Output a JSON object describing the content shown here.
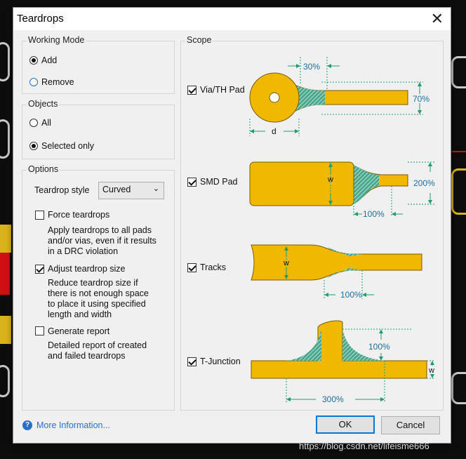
{
  "window": {
    "title": "Teardrops",
    "close_glyph": "✕"
  },
  "working_mode": {
    "label": "Working Mode",
    "options": [
      {
        "label": "Add",
        "selected": true
      },
      {
        "label": "Remove",
        "selected": false
      }
    ]
  },
  "objects": {
    "label": "Objects",
    "options": [
      {
        "label": "All",
        "selected": false
      },
      {
        "label": "Selected only",
        "selected": true
      }
    ]
  },
  "options": {
    "label": "Options",
    "teardrop_style_label": "Teardrop style",
    "teardrop_style_value": "Curved",
    "force": {
      "label": "Force teardrops",
      "checked": false,
      "desc": [
        "Apply teardrops to all pads",
        "and/or vias, even if it results",
        "in a DRC violation"
      ]
    },
    "adjust": {
      "label": "Adjust teardrop size",
      "checked": true,
      "desc": [
        "Reduce teardrop size if",
        "there is not enough space",
        "to place it using specified",
        "length and width"
      ]
    },
    "report": {
      "label": "Generate report",
      "checked": false,
      "desc": [
        "Detailed report of created",
        "and failed teardrops"
      ]
    }
  },
  "scope": {
    "label": "Scope",
    "items": [
      {
        "label": "Via/TH Pad",
        "checked": true
      },
      {
        "label": "SMD Pad",
        "checked": true
      },
      {
        "label": "Tracks",
        "checked": true
      },
      {
        "label": "T-Junction",
        "checked": true
      }
    ],
    "annotations": {
      "via_length": "30%",
      "via_width": "70%",
      "via_d": "d",
      "smd_w": "w",
      "smd_width": "200%",
      "smd_length": "100%",
      "tracks_w": "w",
      "tracks_length": "100%",
      "tj_height": "100%",
      "tj_w": "w",
      "tj_length": "300%"
    }
  },
  "footer": {
    "more_info": "More Information...",
    "ok": "OK",
    "cancel": "Cancel"
  },
  "watermark": "https://blog.csdn.net/lifeisme666",
  "colors": {
    "copper": "#f0b800",
    "teardrop": "#4aa88c",
    "annotation": "#1e9e6e"
  }
}
